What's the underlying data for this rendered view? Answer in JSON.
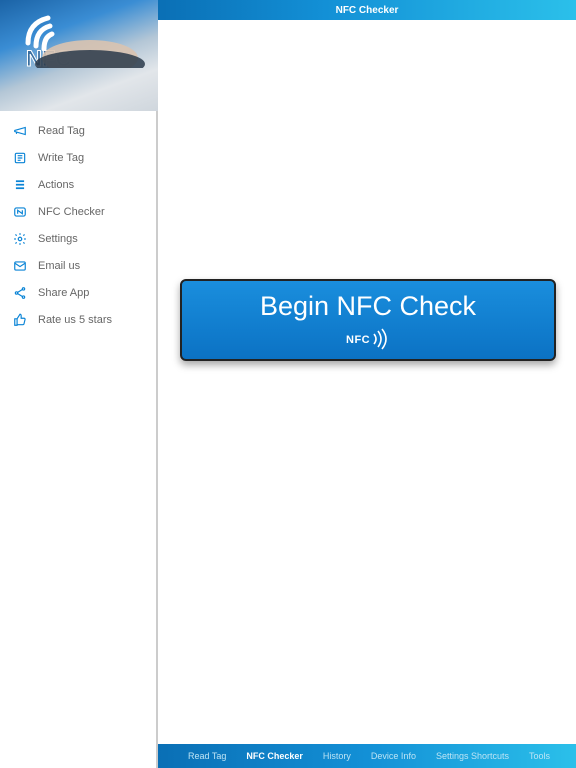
{
  "header": {
    "title": "NFC Checker"
  },
  "logo": {
    "text": "NFC"
  },
  "sidebar": {
    "items": [
      {
        "label": "Read Tag"
      },
      {
        "label": "Write Tag"
      },
      {
        "label": "Actions"
      },
      {
        "label": "NFC Checker"
      },
      {
        "label": "Settings"
      },
      {
        "label": "Email us"
      },
      {
        "label": "Share App"
      },
      {
        "label": "Rate us 5 stars"
      }
    ]
  },
  "main": {
    "begin_label": "Begin NFC Check",
    "nfc_glyph": "NFC"
  },
  "footer": {
    "tabs": [
      {
        "label": "Read Tag"
      },
      {
        "label": "NFC Checker"
      },
      {
        "label": "History"
      },
      {
        "label": "Device Info"
      },
      {
        "label": "Settings Shortcuts"
      },
      {
        "label": "Tools"
      }
    ]
  }
}
